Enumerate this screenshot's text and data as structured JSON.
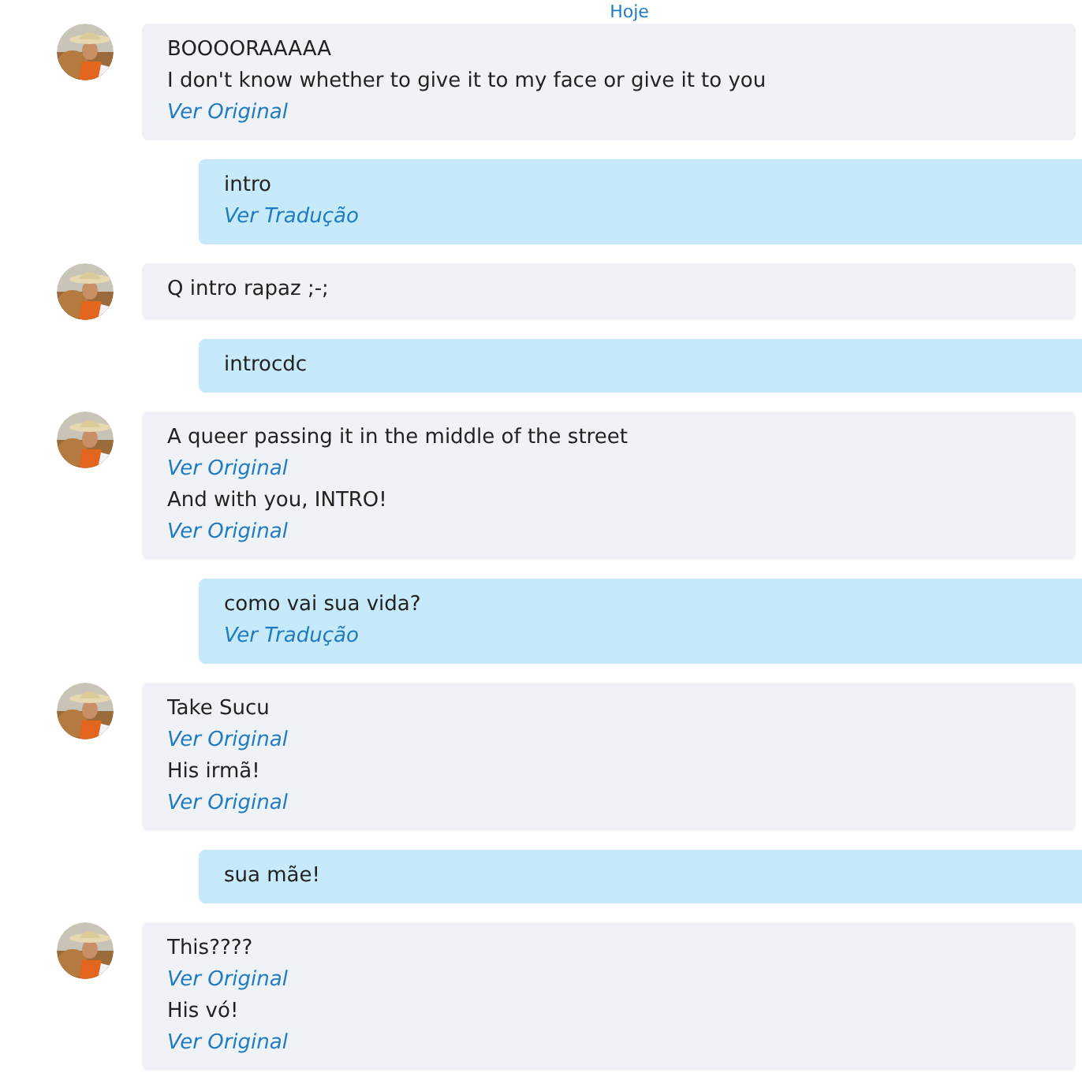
{
  "date_divider": "Hoje",
  "messages": [
    {
      "kind": "incoming",
      "lines": [
        {
          "kind": "text",
          "text": "BOOOORAAAAA"
        },
        {
          "kind": "text",
          "text": "I don't know whether to give it to my face or give it to you"
        },
        {
          "kind": "link",
          "text": "Ver Original"
        }
      ]
    },
    {
      "kind": "outgoing",
      "lines": [
        {
          "kind": "text",
          "text": "intro"
        },
        {
          "kind": "link",
          "text": "Ver Tradução"
        }
      ]
    },
    {
      "kind": "incoming",
      "lines": [
        {
          "kind": "text",
          "text": "Q intro rapaz ;-;"
        }
      ]
    },
    {
      "kind": "outgoing",
      "lines": [
        {
          "kind": "text",
          "text": "introcdc"
        }
      ]
    },
    {
      "kind": "incoming",
      "lines": [
        {
          "kind": "text",
          "text": "A queer passing it in the middle of the street"
        },
        {
          "kind": "link",
          "text": "Ver Original"
        },
        {
          "kind": "text",
          "text": "And with you, INTRO!"
        },
        {
          "kind": "link",
          "text": "Ver Original"
        }
      ]
    },
    {
      "kind": "outgoing",
      "lines": [
        {
          "kind": "text",
          "text": "como vai sua vida?"
        },
        {
          "kind": "link",
          "text": "Ver Tradução"
        }
      ]
    },
    {
      "kind": "incoming",
      "lines": [
        {
          "kind": "text",
          "text": "Take Sucu"
        },
        {
          "kind": "link",
          "text": "Ver Original"
        },
        {
          "kind": "text",
          "text": "His irmã!"
        },
        {
          "kind": "link",
          "text": "Ver Original"
        }
      ]
    },
    {
      "kind": "outgoing",
      "lines": [
        {
          "kind": "text",
          "text": "sua mãe!"
        }
      ]
    },
    {
      "kind": "incoming",
      "lines": [
        {
          "kind": "text",
          "text": "This????"
        },
        {
          "kind": "link",
          "text": "Ver Original"
        },
        {
          "kind": "text",
          "text": "His vó!"
        },
        {
          "kind": "link",
          "text": "Ver Original"
        }
      ]
    }
  ]
}
